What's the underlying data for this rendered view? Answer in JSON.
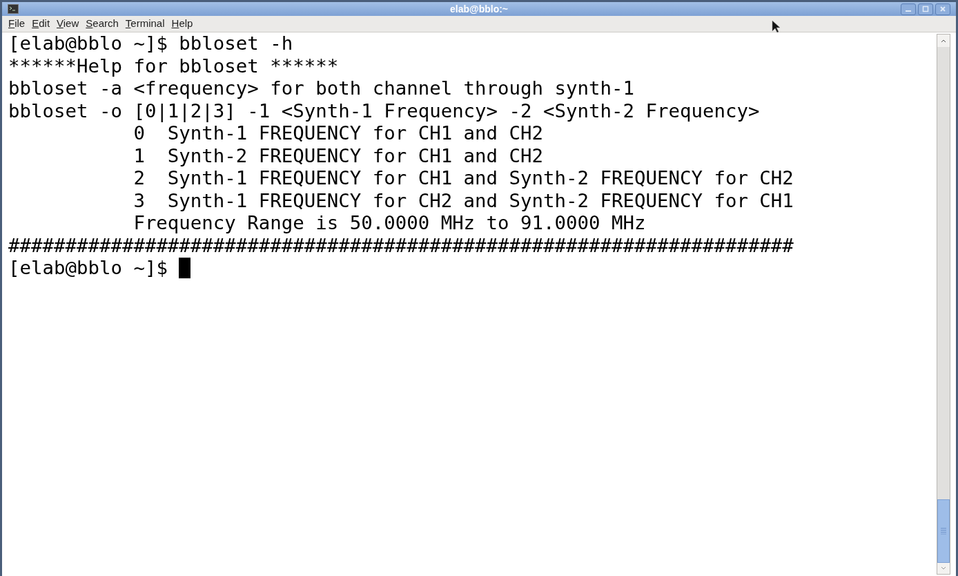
{
  "window": {
    "title": "elab@bblo:~"
  },
  "menu": [
    {
      "label": "File"
    },
    {
      "label": "Edit"
    },
    {
      "label": "View"
    },
    {
      "label": "Search"
    },
    {
      "label": "Terminal"
    },
    {
      "label": "Help"
    }
  ],
  "terminal": {
    "lines": [
      {
        "kind": "plain",
        "text": "[elab@bblo ~]$ bbloset -h"
      },
      {
        "kind": "plain",
        "text": "******Help for bbloset ******"
      },
      {
        "kind": "plain",
        "text": "bbloset -a <frequency> for both channel through synth-1"
      },
      {
        "kind": "plain",
        "text": "bbloset -o [0|1|2|3] -1 <Synth-1 Frequency> -2 <Synth-2 Frequency>"
      },
      {
        "kind": "indented",
        "text": "0  Synth-1 FREQUENCY for CH1 and CH2"
      },
      {
        "kind": "indented",
        "text": "1  Synth-2 FREQUENCY for CH1 and CH2"
      },
      {
        "kind": "indented",
        "text": "2  Synth-1 FREQUENCY for CH1 and Synth-2 FREQUENCY for CH2"
      },
      {
        "kind": "indented",
        "text": "3  Synth-1 FREQUENCY for CH2 and Synth-2 FREQUENCY for CH1"
      },
      {
        "kind": "indented",
        "text": "Frequency Range is 50.0000 MHz to 91.0000 MHz"
      },
      {
        "kind": "plain",
        "text": "#####################################################################"
      },
      {
        "kind": "prompt",
        "text": "[elab@bblo ~]$"
      }
    ]
  }
}
